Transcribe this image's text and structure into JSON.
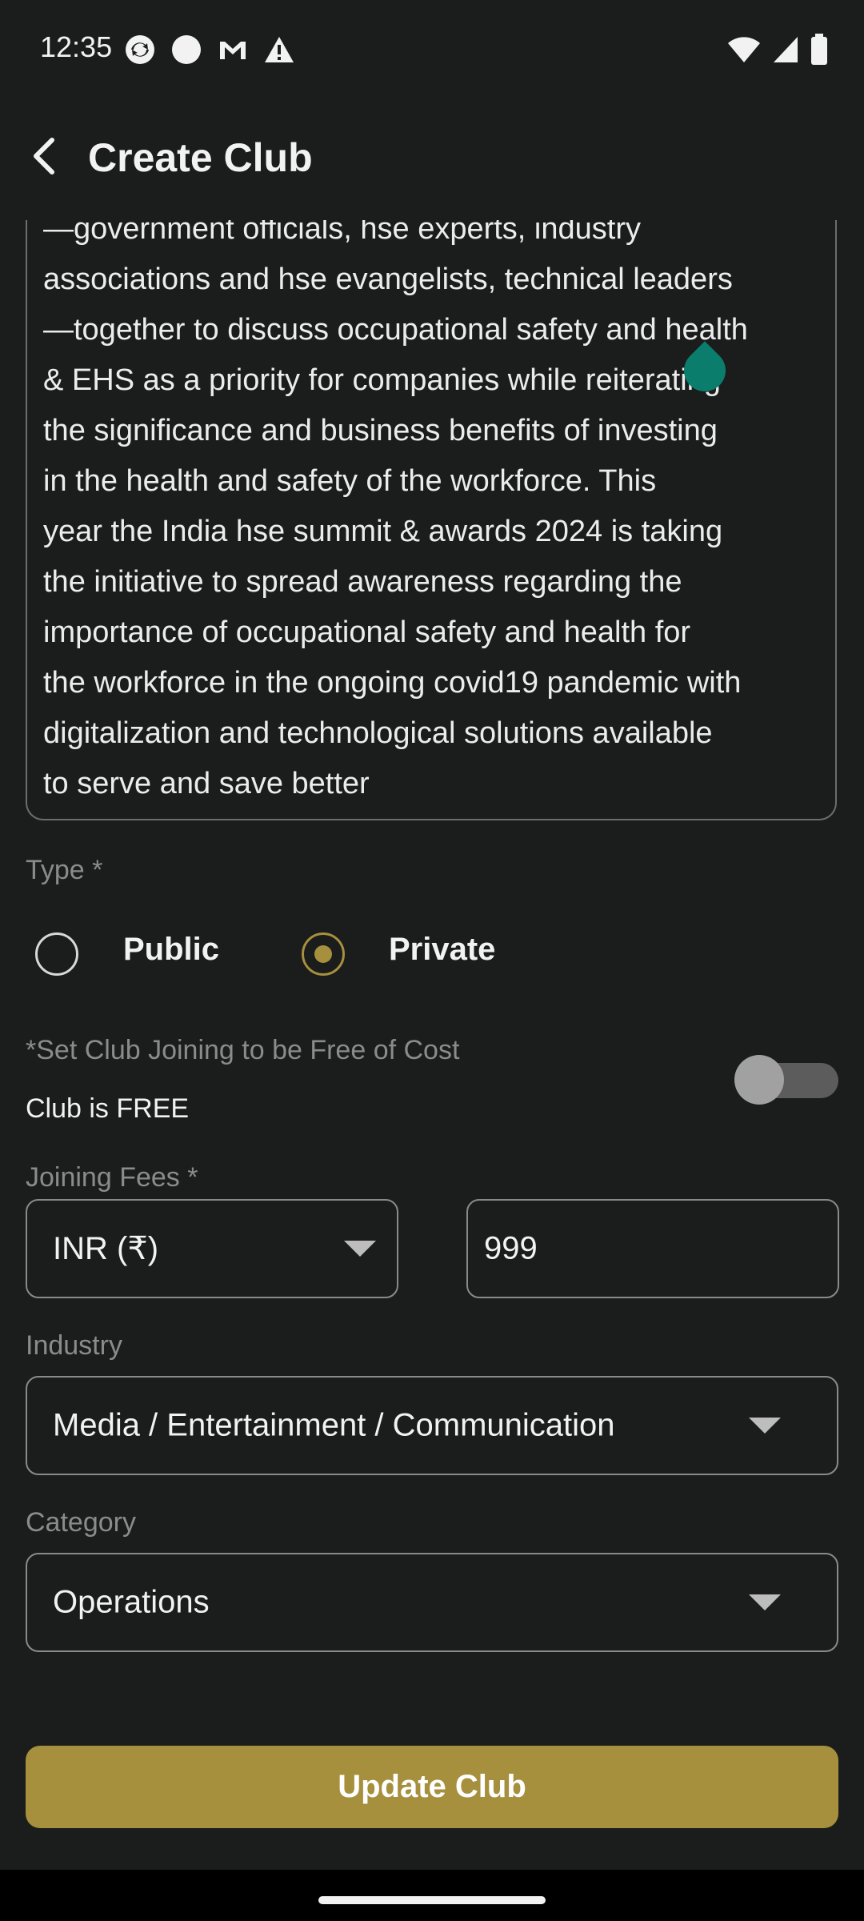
{
  "status_bar": {
    "time": "12:35",
    "icons_left": [
      "sync-icon",
      "circle-icon",
      "gmail-icon",
      "warning-icon"
    ],
    "icons_right": [
      "wifi-icon",
      "signal-icon",
      "battery-icon"
    ]
  },
  "app_bar": {
    "back_icon": "back-arrow-icon",
    "title": "Create Club"
  },
  "description": {
    "text": "—government officials, hse experts, industry\nassociations and hse evangelists, technical leaders\n—together to discuss occupational safety and health\n& EHS as a priority for companies while reiterating\nthe significance and business benefits of investing\nin the health and safety of the workforce. This\nyear the India hse summit & awards 2024 is taking\nthe initiative to spread awareness regarding the\nimportance of occupational safety and health for\nthe workforce in the ongoing covid19 pandemic with\ndigitalization and technological solutions available\nto serve and save better"
  },
  "type": {
    "label": "Type *",
    "options": [
      {
        "label": "Public",
        "selected": false
      },
      {
        "label": "Private",
        "selected": true
      }
    ]
  },
  "free_joining": {
    "note": "*Set Club Joining to be Free of Cost",
    "status": "Club is FREE",
    "toggle_on": false
  },
  "joining_fees": {
    "label": "Joining Fees *",
    "currency": "INR (₹)",
    "amount": "999"
  },
  "industry": {
    "label": "Industry",
    "value": "Media / Entertainment / Communication"
  },
  "category": {
    "label": "Category",
    "value": "Operations"
  },
  "actions": {
    "submit_label": "Update Club"
  },
  "colors": {
    "accent": "#a6903d",
    "background": "#1b1c1c",
    "cursor_handle": "#0b7d6c"
  }
}
